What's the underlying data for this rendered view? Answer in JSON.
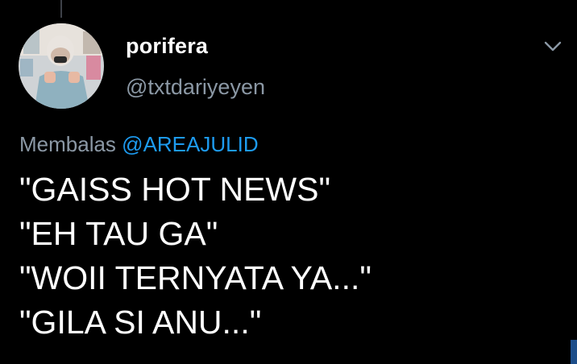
{
  "author": {
    "display_name": "porifera",
    "handle": "@txtdariyeyen"
  },
  "reply": {
    "prefix": "Membalas",
    "mention": "@AREAJULID"
  },
  "tweet": {
    "lines": [
      "\"GAISS HOT NEWS\"",
      "\"EH TAU GA\"",
      "\"WOII TERNYATA YA...\"",
      "\"GILA SI ANU...\""
    ]
  },
  "colors": {
    "background": "#000000",
    "text": "#ffffff",
    "secondary": "#8b98a5",
    "link": "#1d9bf0"
  },
  "icons": {
    "menu": "chevron-down-icon"
  }
}
